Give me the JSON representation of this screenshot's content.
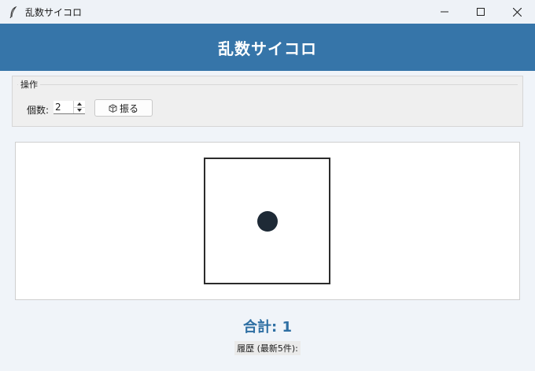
{
  "window": {
    "title": "乱数サイコロ",
    "app_icon": "feather-icon",
    "controls": [
      "minimize-icon",
      "maximize-icon",
      "close-icon"
    ]
  },
  "header": {
    "title": "乱数サイコロ",
    "background": "#3675a9"
  },
  "operations": {
    "legend": "操作",
    "count_label": "個数:",
    "count_value": "2",
    "roll_button_label": "振る",
    "roll_button_icon": "die-icon"
  },
  "dice": [
    {
      "value": 1
    }
  ],
  "result": {
    "total_label": "合計: 1",
    "history_label": "履歴 (最新5件):"
  },
  "colors": {
    "accent": "#2e6fa3",
    "pip": "#1e2a36"
  }
}
